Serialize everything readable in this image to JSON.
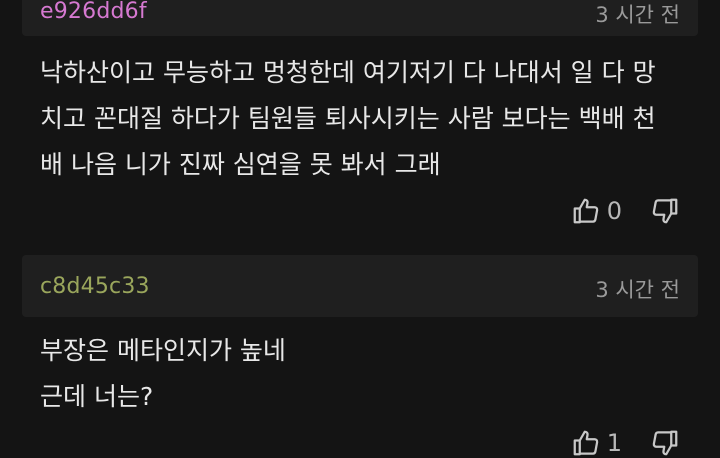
{
  "comments": [
    {
      "author": "e926dd6f",
      "time": "3 시간 전",
      "lines": [
        "낙하산이고 무능하고 멍청한데 여기저기 다 나대서 일 다 망",
        "치고 꼰대질 하다가 팀원들 퇴사시키는 사람 보다는 백배 천",
        "배 나음 니가 진짜 심연을 못 봐서 그래"
      ],
      "likes": "0"
    },
    {
      "author": "c8d45c33",
      "time": "3 시간 전",
      "lines": [
        "부장은 메타인지가 높네",
        "근데 너는?"
      ],
      "likes": "1"
    }
  ],
  "colors": {
    "background": "#141414",
    "header_bg": "#1f1f1f",
    "author1": "#d679d1",
    "author2": "#9aa65c"
  },
  "icons": [
    "thumbs-up-icon",
    "thumbs-down-icon"
  ]
}
